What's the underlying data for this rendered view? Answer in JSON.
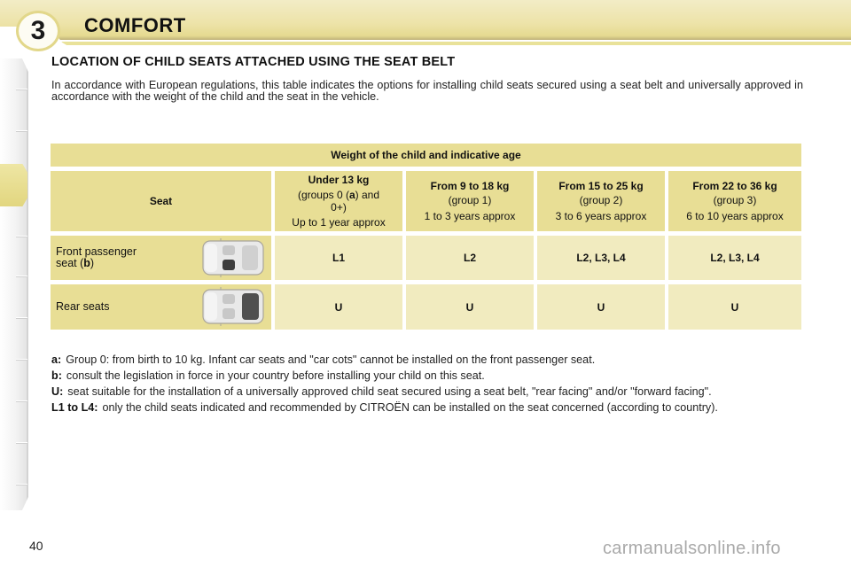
{
  "chapter": {
    "number": "3",
    "title": "COMFORT"
  },
  "section_title": "LOCATION OF CHILD SEATS ATTACHED USING THE SEAT BELT",
  "intro": "In accordance with European regulations, this table indicates the options for installing child seats secured using a seat belt and universally approved in accordance with the weight of the child and the seat in the vehicle.",
  "table": {
    "weight_header": "Weight of the child and indicative age",
    "seat_header": "Seat",
    "columns": [
      {
        "weight": "Under 13 kg",
        "group_prefix": "(groups 0 (",
        "group_bold": "a",
        "group_suffix": ") and 0+)",
        "age": "Up to 1 year approx"
      },
      {
        "weight": "From 9 to 18 kg",
        "group": "(group 1)",
        "age": "1 to 3 years approx"
      },
      {
        "weight": "From 15 to 25 kg",
        "group": "(group 2)",
        "age": "3 to 6 years approx"
      },
      {
        "weight": "From 22 to 36 kg",
        "group": "(group 3)",
        "age": "6 to 10 years approx"
      }
    ],
    "rows": [
      {
        "label_prefix": "Front passenger seat (",
        "label_bold": "b",
        "label_suffix": ")",
        "icon": "car-front-passenger-seat-icon",
        "values": [
          "L1",
          "L2",
          "L2, L3, L4",
          "L2, L3, L4"
        ]
      },
      {
        "label": "Rear seats",
        "icon": "car-rear-seats-icon",
        "values": [
          "U",
          "U",
          "U",
          "U"
        ]
      }
    ]
  },
  "notes": [
    {
      "key": "a:",
      "text": "Group 0: from birth to 10 kg. Infant car seats and \"car cots\" cannot be installed on the front passenger seat."
    },
    {
      "key": "b:",
      "text": "consult the legislation in force in your country before installing your child on this seat."
    },
    {
      "key": "U:",
      "text": "seat suitable for the installation of a universally approved child seat secured using a seat belt, \"rear facing\" and/or \"forward facing\"."
    },
    {
      "key": "L1 to L4:",
      "text": "only the child seats indicated and recommended by CITROËN can be installed on the seat concerned (according to country)."
    }
  ],
  "page_number": "40",
  "watermark": "carmanualsonline.info",
  "colors": {
    "header_band": "#ede3a8",
    "table_header": "#e8de95",
    "table_cell": "#f1ebbf",
    "watermark": "#a9a9a9"
  }
}
